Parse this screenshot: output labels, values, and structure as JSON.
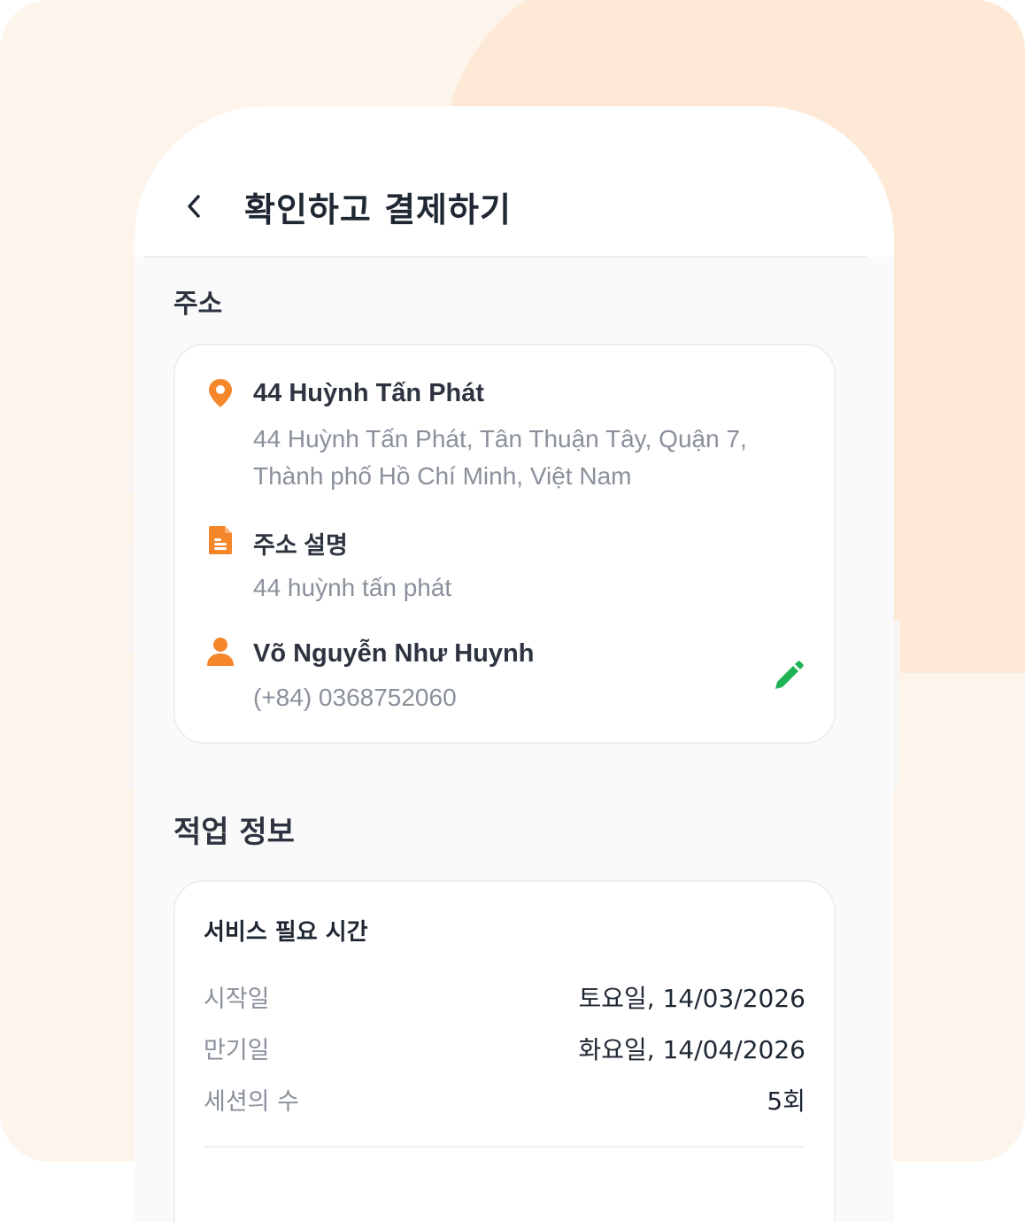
{
  "header": {
    "title": "확인하고 결제하기"
  },
  "address_section": {
    "title": "주소",
    "location": {
      "name": "44 Huỳnh Tấn Phát",
      "line1": "44 Huỳnh Tấn Phát, Tân Thuận Tây, Quận 7,",
      "line2": "Thành phố Hồ Chí Minh, Việt Nam"
    },
    "description": {
      "label": "주소 설명",
      "value": "44 huỳnh tấn phát"
    },
    "contact": {
      "name": "Võ Nguyễn Như Huynh",
      "phone": "(+84) 0368752060"
    }
  },
  "job_section": {
    "title": "적업 정보",
    "card_title": "서비스 필요 시간",
    "rows": [
      {
        "label": "시작일",
        "value": "토요일, 14/03/2026"
      },
      {
        "label": "만기일",
        "value": "화요일, 14/04/2026"
      },
      {
        "label": "세션의 수",
        "value": "5회"
      }
    ]
  },
  "colors": {
    "accent": "#f5862a",
    "edit": "#1fb356",
    "background": "#fdf5ec"
  },
  "icons": {
    "back": "chevron-left-icon",
    "location": "map-pin-icon",
    "description": "document-icon",
    "contact": "person-icon",
    "edit": "pencil-icon"
  }
}
